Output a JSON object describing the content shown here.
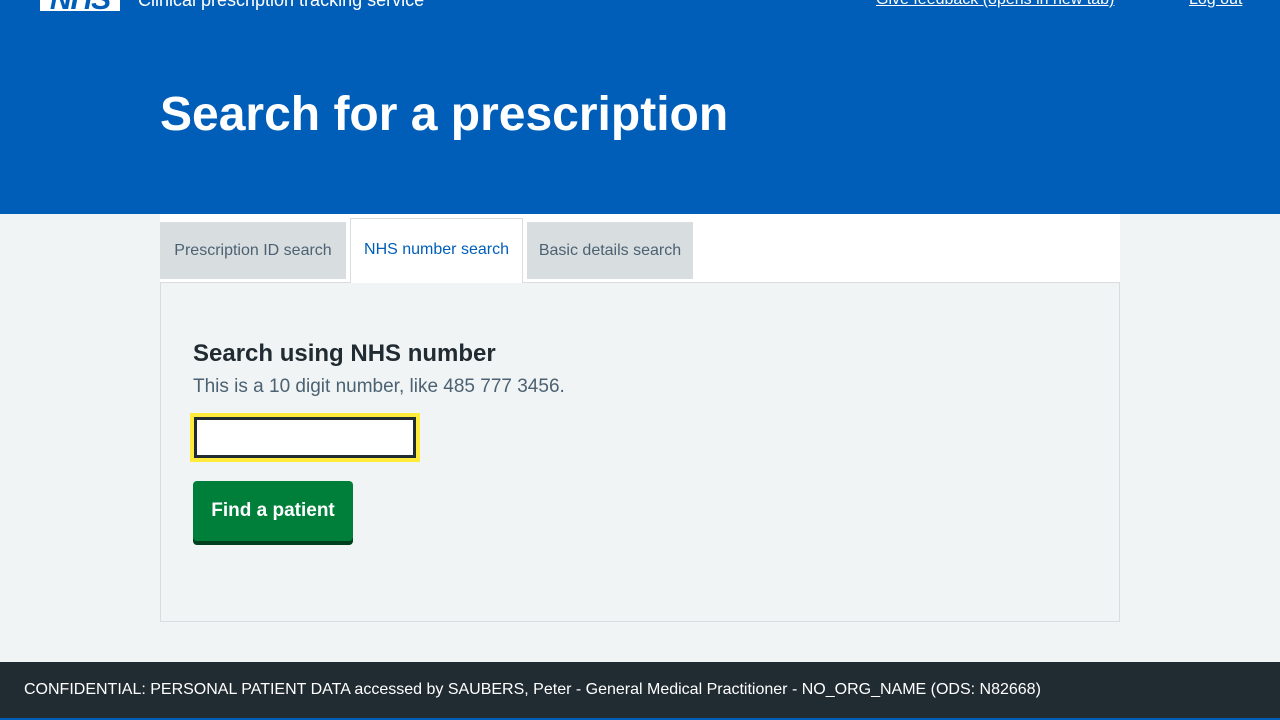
{
  "header": {
    "logo_text": "NHS",
    "service_name": "Clinical prescription tracking service",
    "links": {
      "feedback": "Give feedback (opens in new tab)",
      "logout": "Log out"
    },
    "page_title": "Search for a prescription"
  },
  "tabs": [
    {
      "label": "Prescription ID search",
      "selected": false
    },
    {
      "label": "NHS number search",
      "selected": true
    },
    {
      "label": "Basic details search",
      "selected": false
    }
  ],
  "panel": {
    "heading": "Search using NHS number",
    "hint": "This is a 10 digit number, like 485 777 3456.",
    "input_value": "",
    "button_label": "Find a patient"
  },
  "footer": {
    "text": "CONFIDENTIAL: PERSONAL PATIENT DATA accessed by SAUBERS, Peter - General Medical Practitioner - NO_ORG_NAME (ODS: N82668)"
  },
  "colors": {
    "brand_blue": "#005eb8",
    "button_green": "#007f3b",
    "focus_yellow": "#ffeb3b",
    "footer_dark": "#212b32"
  }
}
